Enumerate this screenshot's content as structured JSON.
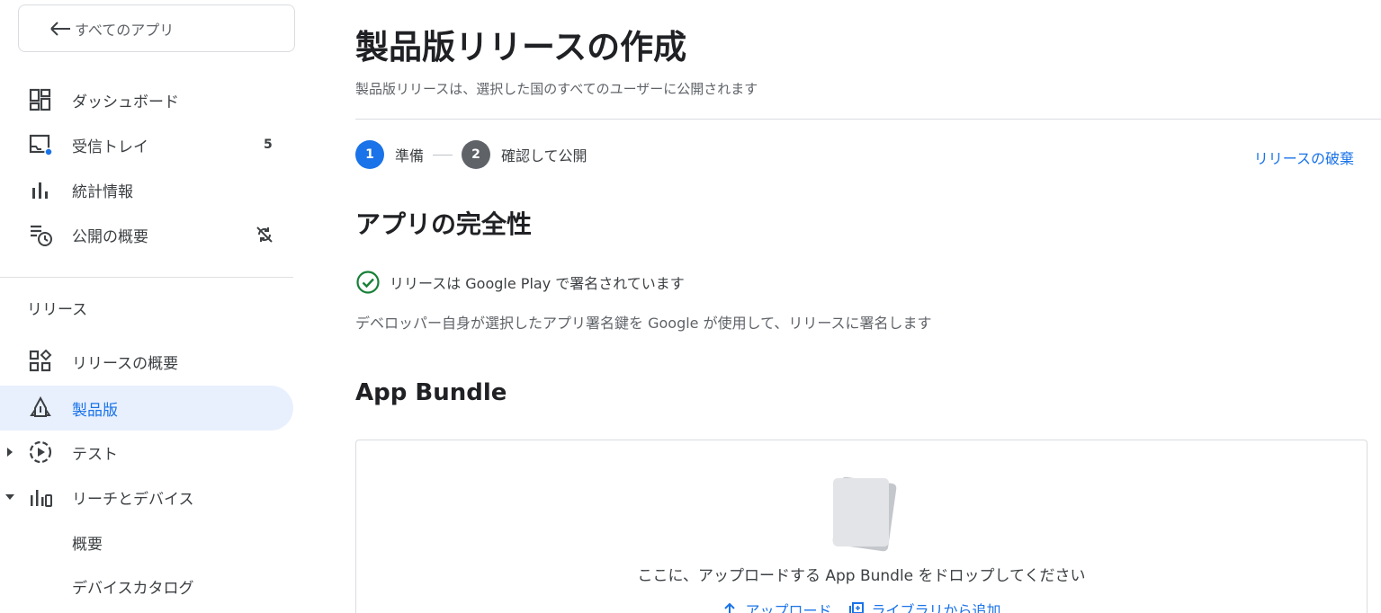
{
  "sidebar": {
    "back_label": "すべてのアプリ",
    "items": [
      {
        "label": "ダッシュボード",
        "icon": "dashboard-icon"
      },
      {
        "label": "受信トレイ",
        "icon": "inbox-icon",
        "count": "5"
      },
      {
        "label": "統計情報",
        "icon": "bar-chart-icon"
      },
      {
        "label": "公開の概要",
        "icon": "publishing-overview-icon",
        "trail_icon": "sync-off-icon"
      }
    ],
    "section_title": "リリース",
    "release_items": [
      {
        "label": "リリースの概要",
        "icon": "releases-overview-icon"
      },
      {
        "label": "製品版",
        "icon": "production-icon",
        "active": true
      },
      {
        "label": "テスト",
        "icon": "testing-icon",
        "caret": "right"
      },
      {
        "label": "リーチとデバイス",
        "icon": "reach-devices-icon",
        "caret": "down"
      },
      {
        "label": "概要"
      },
      {
        "label": "デバイスカタログ"
      }
    ]
  },
  "main": {
    "title": "製品版リリースの作成",
    "subtitle": "製品版リリースは、選択した国のすべてのユーザーに公開されます",
    "steps": [
      {
        "number": "1",
        "label": "準備",
        "state": "active"
      },
      {
        "number": "2",
        "label": "確認して公開",
        "state": "inactive"
      }
    ],
    "discard_label": "リリースの破棄",
    "integrity_heading": "アプリの完全性",
    "signed_text": "リリースは Google Play で署名されています",
    "signing_desc": "デベロッパー自身が選択したアプリ署名鍵を Google が使用して、リリースに署名します",
    "bundle_heading": "App Bundle",
    "drop_text": "ここに、アップロードする App Bundle をドロップしてください",
    "upload_label": "アップロード",
    "library_label": "ライブラリから追加"
  },
  "colors": {
    "accent": "#1a73e8",
    "active_bg": "#e8f0fe",
    "success": "#188038"
  }
}
